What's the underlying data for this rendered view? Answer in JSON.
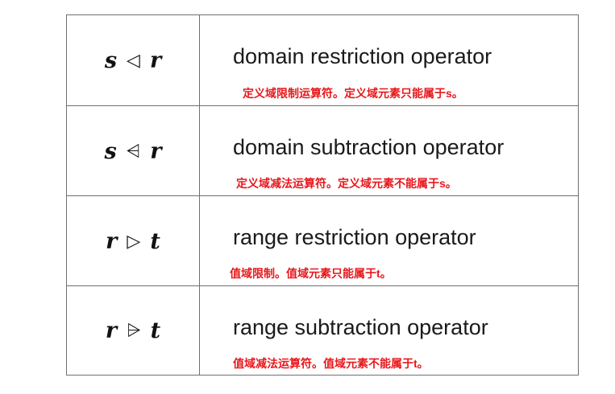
{
  "rows": [
    {
      "left": "s",
      "op": "◁",
      "right": "r",
      "description": "domain restriction operator",
      "note": "定义域限制运算符。定义域元素只能属于s。"
    },
    {
      "left": "s",
      "op": "⩤",
      "right": "r",
      "description": "domain subtraction operator",
      "note": "定义域减法运算符。定义域元素不能属于s。"
    },
    {
      "left": "r",
      "op": "▷",
      "right": "t",
      "description": "range restriction operator",
      "note": "值域限制。值域元素只能属于t。"
    },
    {
      "left": "r",
      "op": "⩥",
      "right": "t",
      "description": "range subtraction operator",
      "note": "值域减法运算符。值域元素不能属于t。"
    }
  ]
}
